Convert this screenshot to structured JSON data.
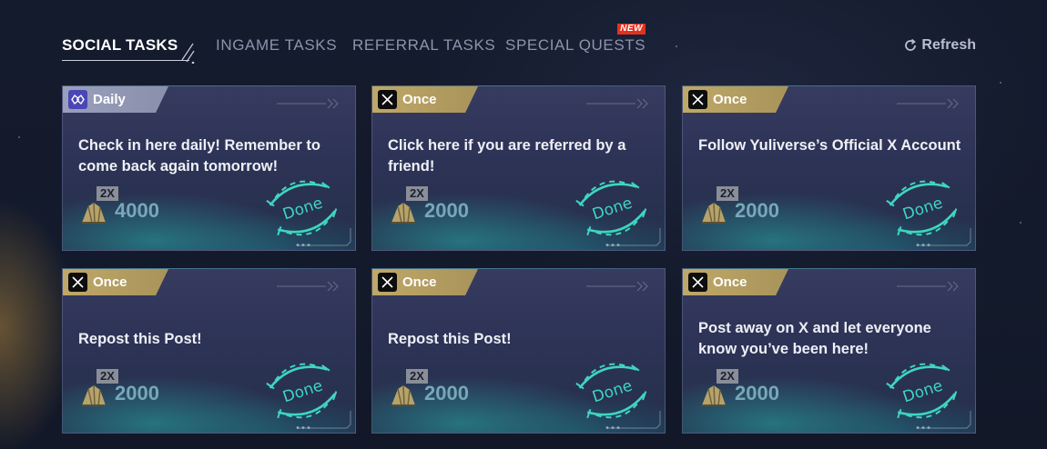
{
  "tabs": {
    "social": "SOCIAL TASKS",
    "ingame": "INGAME TASKS",
    "referral": "REFERRAL TASKS",
    "special": "SPECIAL QUESTS",
    "special_badge": "NEW"
  },
  "refresh_label": "Refresh",
  "cards": [
    {
      "tag": "Daily",
      "icon": "yuliverse-logo-icon",
      "title": "Check in here daily! Remember to come back again tomorrow!",
      "multiplier": "2X",
      "reward": "4000",
      "status": "Done"
    },
    {
      "tag": "Once",
      "icon": "x-logo-icon",
      "title": "Click here if you are referred by a friend!",
      "multiplier": "2X",
      "reward": "2000",
      "status": "Done"
    },
    {
      "tag": "Once",
      "icon": "x-logo-icon",
      "title": "Follow Yuliverse’s Official X Account",
      "multiplier": "2X",
      "reward": "2000",
      "status": "Done"
    },
    {
      "tag": "Once",
      "icon": "x-logo-icon",
      "title": "Repost this Post!",
      "multiplier": "2X",
      "reward": "2000",
      "status": "Done"
    },
    {
      "tag": "Once",
      "icon": "x-logo-icon",
      "title": "Repost this Post!",
      "multiplier": "2X",
      "reward": "2000",
      "status": "Done"
    },
    {
      "tag": "Once",
      "icon": "x-logo-icon",
      "title": "Post away on X and let everyone know you’ve been here!",
      "multiplier": "2X",
      "reward": "2000",
      "status": "Done"
    }
  ],
  "colors": {
    "accent_done": "#3fd6c0",
    "tag_once": "#b49f62",
    "tag_daily": "#9aa0bc",
    "new_badge": "#e0321e"
  }
}
